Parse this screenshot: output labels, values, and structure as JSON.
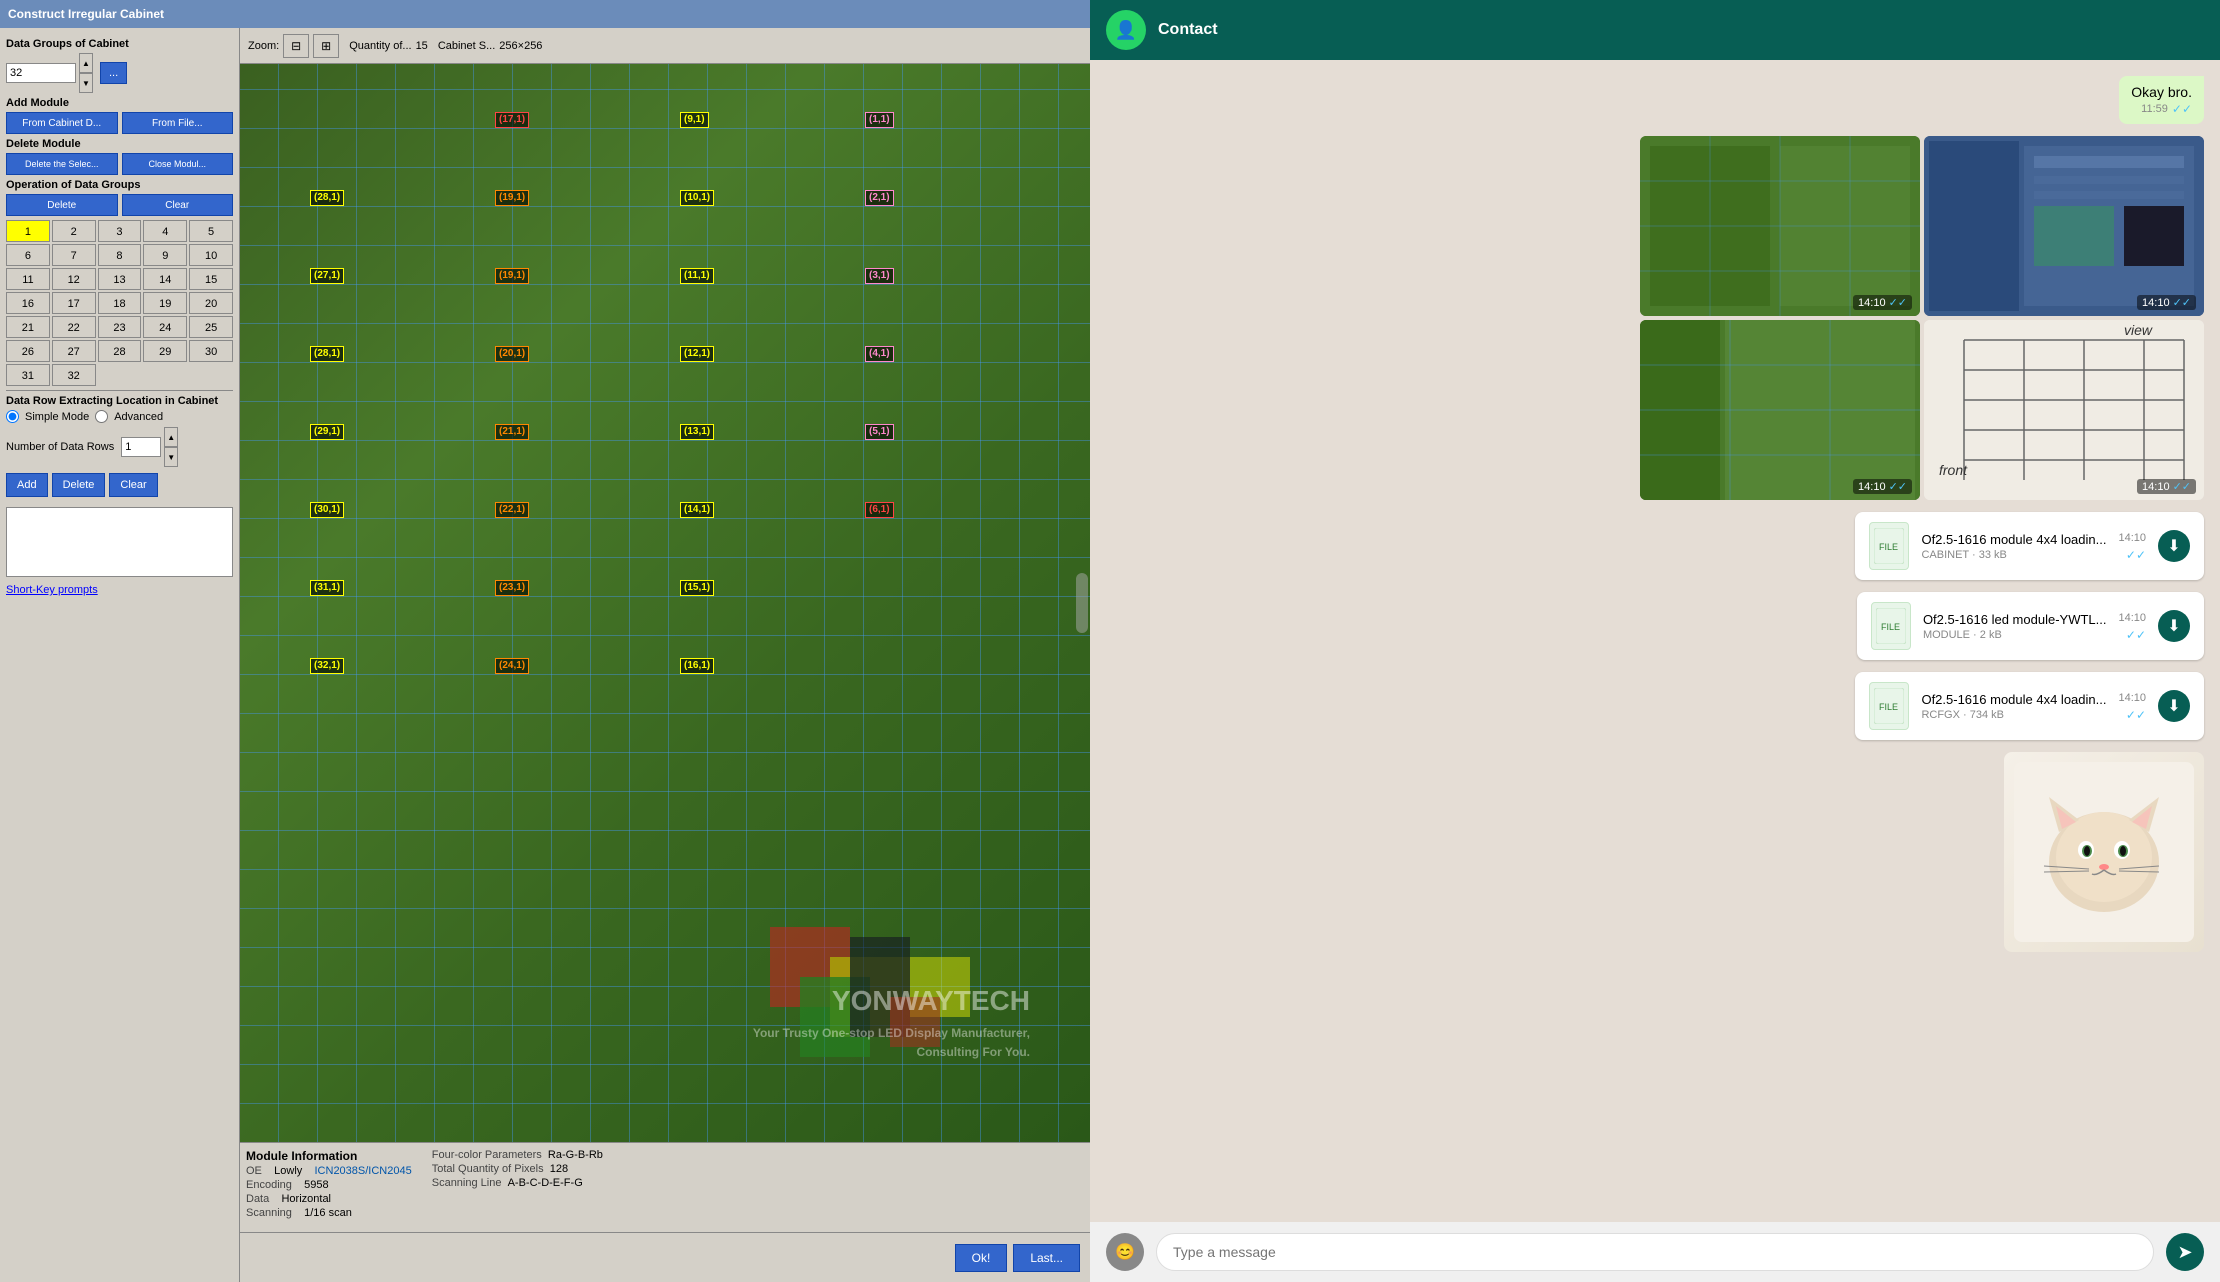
{
  "app": {
    "title": "Construct Irregular Cabinet"
  },
  "toolbar": {
    "zoom_label": "Zoom:",
    "quantity_label": "Quantity of...",
    "quantity_value": "15",
    "cabinet_size_label": "Cabinet S...",
    "cabinet_size_value": "256×256"
  },
  "sidebar": {
    "data_groups_label": "Data Groups of Cabinet",
    "data_groups_value": "32",
    "add_module_label": "Add Module",
    "from_cabinet_btn": "From Cabinet D...",
    "from_file_btn": "From File...",
    "delete_module_label": "Delete Module",
    "delete_by_select_btn": "Delete the Selec...",
    "close_module_btn": "Close Modul...",
    "operation_label": "Operation of Data Groups",
    "delete_btn": "Delete",
    "clear_btn": "Clear",
    "numbers": [
      1,
      2,
      3,
      4,
      5,
      6,
      7,
      8,
      9,
      10,
      11,
      12,
      13,
      14,
      15,
      16,
      17,
      18,
      19,
      20,
      21,
      22,
      23,
      24,
      25,
      26,
      27,
      28,
      29,
      30,
      31,
      32
    ],
    "active_number": 1,
    "data_row_label": "Data Row Extracting Location in Cabinet",
    "simple_mode": "Simple Mode",
    "advanced": "Advanced",
    "num_data_rows_label": "Number of Data Rows",
    "num_data_rows_value": "1",
    "add_btn": "Add",
    "delete_action_btn": "Delete",
    "clear_action_btn": "Clear",
    "short_key_link": "Short-Key prompts"
  },
  "module_info": {
    "section_label": "Module Information",
    "oe_label": "OE",
    "oe_value": "Lowly",
    "oe_code": "ICN2038S/ICN2045",
    "encoding_label": "Encoding",
    "encoding_value": "5958",
    "four_color_label": "Four-color Parameters",
    "four_color_value": "Ra-G-B-Rb",
    "data_label": "Data",
    "data_value": "Horizontal",
    "total_pixels_label": "Total Quantity of Pixels",
    "total_pixels_value": "128",
    "scanning_label": "Scanning",
    "scanning_value": "1/16 scan",
    "scanning_line_label": "Scanning Line",
    "scanning_line_value": "A-B-C-D-E-F-G"
  },
  "grid_labels": [
    {
      "text": "(17,1)",
      "style": "red",
      "row": 0,
      "col": 1
    },
    {
      "text": "(9,1)",
      "style": "yellow",
      "row": 0,
      "col": 2
    },
    {
      "text": "(1,1)",
      "style": "pink",
      "row": 0,
      "col": 3
    },
    {
      "text": "(28,1)",
      "style": "yellow",
      "row": 1,
      "col": 0
    },
    {
      "text": "(19,1)",
      "style": "orange",
      "row": 1,
      "col": 1
    },
    {
      "text": "(10,1)",
      "style": "yellow",
      "row": 1,
      "col": 2
    },
    {
      "text": "(2,1)",
      "style": "pink",
      "row": 1,
      "col": 3
    },
    {
      "text": "(27,1)",
      "style": "yellow",
      "row": 2,
      "col": 0
    },
    {
      "text": "(19,1)",
      "style": "orange",
      "row": 2,
      "col": 1
    },
    {
      "text": "(11,1)",
      "style": "yellow",
      "row": 2,
      "col": 2
    },
    {
      "text": "(3,1)",
      "style": "pink",
      "row": 2,
      "col": 3
    },
    {
      "text": "(28,1)",
      "style": "yellow",
      "row": 3,
      "col": 0
    },
    {
      "text": "(20,1)",
      "style": "orange",
      "row": 3,
      "col": 1
    },
    {
      "text": "(12,1)",
      "style": "yellow",
      "row": 3,
      "col": 2
    },
    {
      "text": "(4,1)",
      "style": "pink",
      "row": 3,
      "col": 3
    },
    {
      "text": "(29,1)",
      "style": "yellow",
      "row": 4,
      "col": 0
    },
    {
      "text": "(21,1)",
      "style": "orange",
      "row": 4,
      "col": 1
    },
    {
      "text": "(13,1)",
      "style": "yellow",
      "row": 4,
      "col": 2
    },
    {
      "text": "(5,1)",
      "style": "pink",
      "row": 4,
      "col": 3
    },
    {
      "text": "(30,1)",
      "style": "yellow",
      "row": 5,
      "col": 0
    },
    {
      "text": "(22,1)",
      "style": "orange",
      "row": 5,
      "col": 1
    },
    {
      "text": "(14,1)",
      "style": "yellow",
      "row": 5,
      "col": 2
    },
    {
      "text": "(6,1)",
      "style": "red",
      "row": 5,
      "col": 3
    },
    {
      "text": "(31,1)",
      "style": "yellow",
      "row": 6,
      "col": 0
    },
    {
      "text": "(23,1)",
      "style": "orange",
      "row": 6,
      "col": 1
    },
    {
      "text": "(15,1)",
      "style": "yellow",
      "row": 6,
      "col": 2
    },
    {
      "text": "(32,1)",
      "style": "yellow",
      "row": 7,
      "col": 0
    },
    {
      "text": "(24,1)",
      "style": "orange",
      "row": 7,
      "col": 1
    },
    {
      "text": "(16,1)",
      "style": "yellow",
      "row": 7,
      "col": 2
    }
  ],
  "chat": {
    "contact_name": "Contact",
    "message_text": "Okay bro.",
    "message_time": "11:59",
    "images_time": "14:10",
    "files": [
      {
        "name": "Of2.5-1616 module 4x4 loadin...",
        "type": "CABINET",
        "size": "33 kB",
        "time": "14:10"
      },
      {
        "name": "Of2.5-1616 led module-YWTL...",
        "type": "MODULE",
        "size": "2 kB",
        "time": "14:10"
      },
      {
        "name": "Of2.5-1616 module 4x4 loadin...",
        "type": "RCFGX",
        "size": "734 kB",
        "time": "14:10"
      }
    ],
    "watermark_line1": "Your Trusty One-stop LED Display Manufacturer,",
    "watermark_line2": "Consulting For You.",
    "brand": "YONWAYTECH"
  },
  "bottom_buttons": {
    "ok_label": "Ok!",
    "last_label": "Last..."
  }
}
